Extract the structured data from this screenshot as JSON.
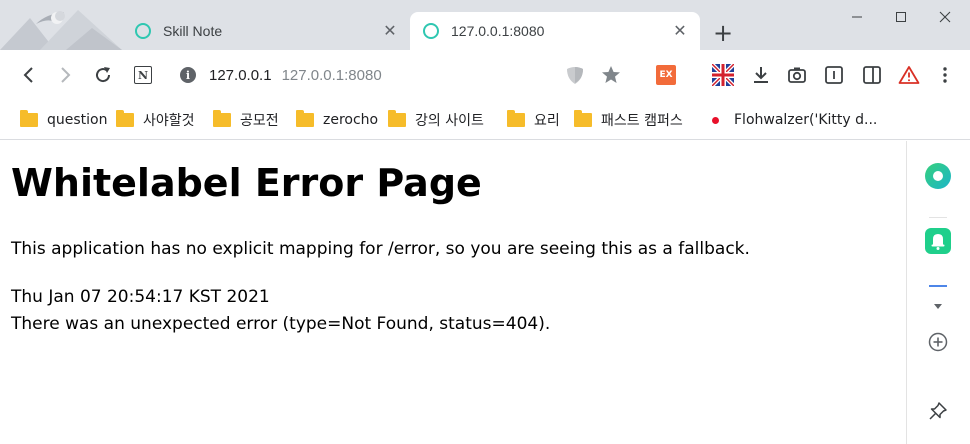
{
  "tabs": [
    {
      "title": "Skill Note",
      "close": "✕"
    },
    {
      "title": "127.0.0.1:8080",
      "close": "✕"
    }
  ],
  "new_tab": "+",
  "icons": {
    "back": "arrow-left-icon",
    "forward": "arrow-right-icon",
    "reload": "reload-icon",
    "notion": "notion-icon",
    "info": "info-icon",
    "shield": "shield-icon",
    "star": "star-icon",
    "extension": "ex-extension-icon",
    "flag": "uk-flag-icon",
    "download": "download-icon",
    "camera": "camera-icon",
    "reader": "reader-icon",
    "sidebar": "sidebar-icon",
    "warning": "warning-icon",
    "menu": "kebab-menu-icon"
  },
  "address": {
    "info_glyph": "i",
    "host": "127.0.0.1",
    "rest": "127.0.0.1:8080"
  },
  "toolbar": {
    "notion_label": "N",
    "ex_label": "EX"
  },
  "bookmarks": [
    {
      "label": "question",
      "type": "folder"
    },
    {
      "label": "사야할것",
      "type": "folder"
    },
    {
      "label": "공모전",
      "type": "folder"
    },
    {
      "label": "zerocho",
      "type": "folder"
    },
    {
      "label": "강의 사이트",
      "type": "folder"
    },
    {
      "label": "요리",
      "type": "folder"
    },
    {
      "label": "패스트 캠퍼스",
      "type": "folder"
    },
    {
      "label": "Flohwalzer('Kitty d...",
      "type": "link"
    }
  ],
  "page": {
    "heading": "Whitelabel Error Page",
    "message": "This application has no explicit mapping for /error, so you are seeing this as a fallback.",
    "timestamp": "Thu Jan 07 20:54:17 KST 2021",
    "error": "There was an unexpected error (type=Not Found, status=404)."
  },
  "colors": {
    "tab_strip": "#dee1e6",
    "favicon": "#2fc7b1",
    "folder": "#f6bc2a",
    "ex_badge": "#f26b3a",
    "warning": "#d93025",
    "sidebar_green": "#20c997"
  }
}
